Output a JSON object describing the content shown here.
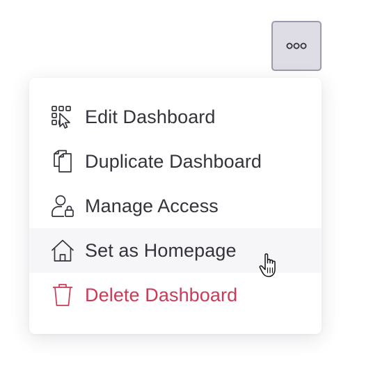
{
  "more_button": {
    "icon": "more-horizontal-icon"
  },
  "menu": {
    "items": [
      {
        "label": "Edit Dashboard",
        "icon": "edit-dashboard-icon"
      },
      {
        "label": "Duplicate Dashboard",
        "icon": "duplicate-icon"
      },
      {
        "label": "Manage Access",
        "icon": "user-lock-icon"
      },
      {
        "label": "Set as Homepage",
        "icon": "home-icon",
        "state": "hovered"
      },
      {
        "label": "Delete Dashboard",
        "icon": "trash-icon",
        "variant": "danger"
      }
    ]
  },
  "colors": {
    "text": "#33333c",
    "danger": "#cd3a55",
    "hover_bg": "#f6f6f8",
    "button_bg": "#dedde6",
    "button_border": "#9c9aae"
  },
  "cursor": {
    "icon": "hand-pointer-cursor-icon"
  }
}
